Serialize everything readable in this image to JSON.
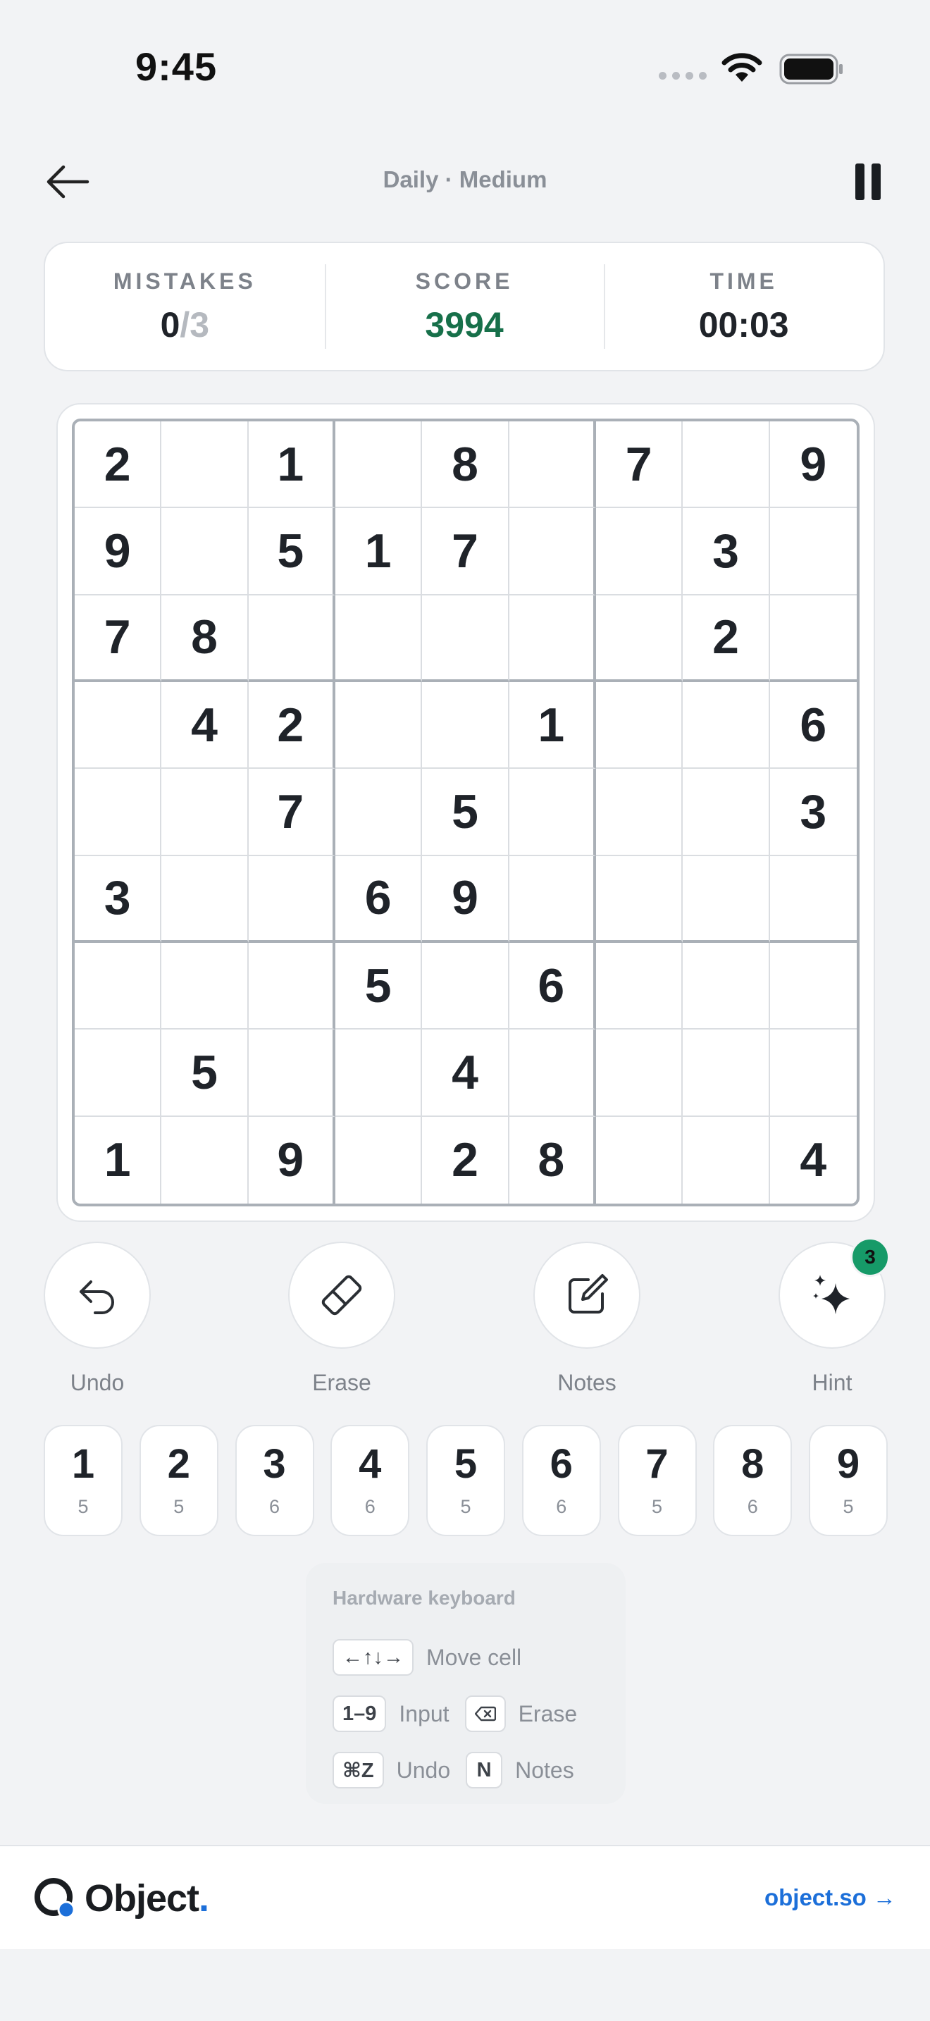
{
  "status_bar": {
    "time": "9:45"
  },
  "header": {
    "title": "Daily · Medium"
  },
  "stats": {
    "mistakes_label": "MISTAKES",
    "mistakes_value": "0",
    "mistakes_total": "/3",
    "score_label": "SCORE",
    "score_value": "3994",
    "time_label": "TIME",
    "time_value": "00:03"
  },
  "board": [
    [
      "2",
      "",
      "1",
      "",
      "8",
      "",
      "7",
      "",
      "9"
    ],
    [
      "9",
      "",
      "5",
      "1",
      "7",
      "",
      "",
      "3",
      ""
    ],
    [
      "7",
      "8",
      "",
      "",
      "",
      "",
      "",
      "2",
      ""
    ],
    [
      "",
      "4",
      "2",
      "",
      "",
      "1",
      "",
      "",
      "6"
    ],
    [
      "",
      "",
      "7",
      "",
      "5",
      "",
      "",
      "",
      "3"
    ],
    [
      "3",
      "",
      "",
      "6",
      "9",
      "",
      "",
      "",
      ""
    ],
    [
      "",
      "",
      "",
      "5",
      "",
      "6",
      "",
      "",
      ""
    ],
    [
      "",
      "5",
      "",
      "",
      "4",
      "",
      "",
      "",
      ""
    ],
    [
      "1",
      "",
      "9",
      "",
      "2",
      "8",
      "",
      "",
      "4"
    ]
  ],
  "tools": {
    "undo": "Undo",
    "erase": "Erase",
    "notes": "Notes",
    "hint": "Hint",
    "hint_count": "3"
  },
  "numpad": [
    {
      "digit": "1",
      "remaining": "5"
    },
    {
      "digit": "2",
      "remaining": "5"
    },
    {
      "digit": "3",
      "remaining": "6"
    },
    {
      "digit": "4",
      "remaining": "6"
    },
    {
      "digit": "5",
      "remaining": "5"
    },
    {
      "digit": "6",
      "remaining": "6"
    },
    {
      "digit": "7",
      "remaining": "5"
    },
    {
      "digit": "8",
      "remaining": "6"
    },
    {
      "digit": "9",
      "remaining": "5"
    }
  ],
  "keyboard_help": {
    "title": "Hardware keyboard",
    "arrows_key": "←↑↓→",
    "move_label": "Move cell",
    "digits_key": "1–9",
    "input_label": "Input",
    "erase_label": "Erase",
    "undo_key": "⌘Z",
    "undo_label": "Undo",
    "notes_key": "N",
    "notes_label": "Notes"
  },
  "footer": {
    "brand": "Object",
    "brand_dot": ".",
    "link": "object.so →"
  }
}
